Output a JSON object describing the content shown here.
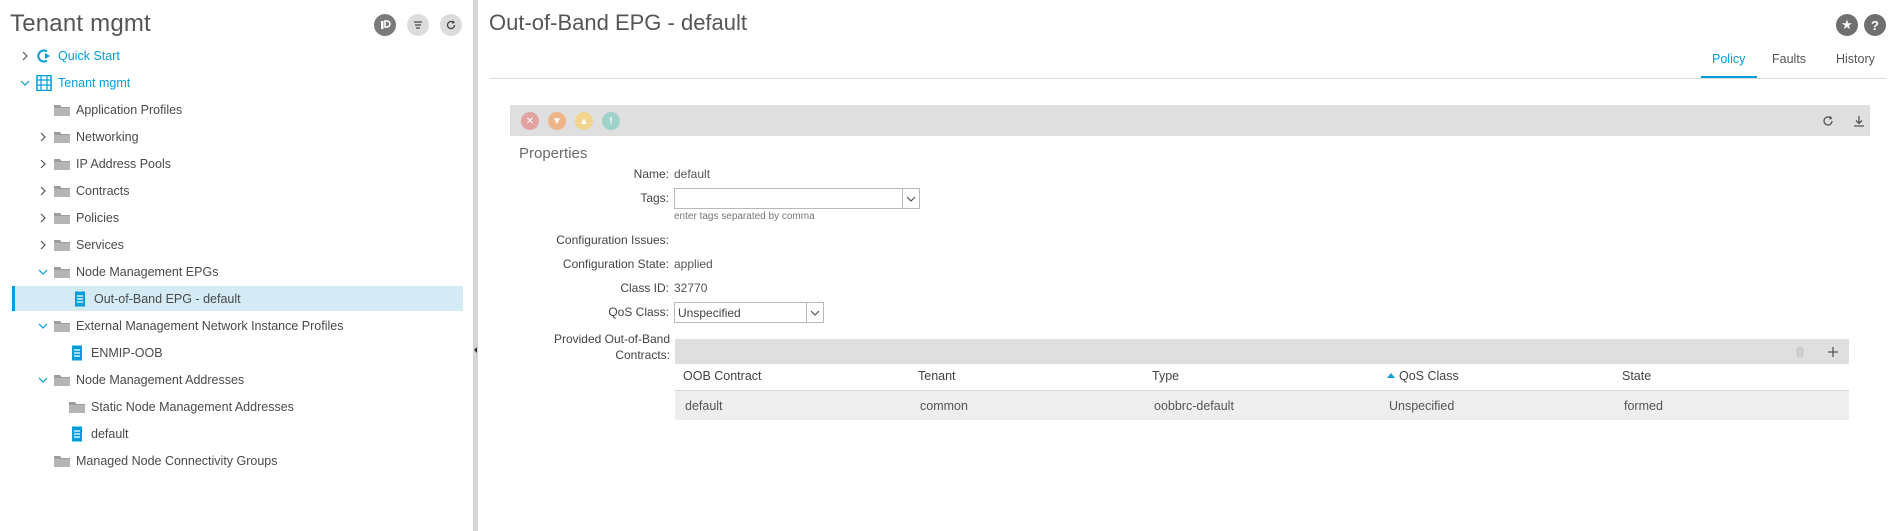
{
  "left_pane": {
    "title": "Tenant mgmt",
    "tree": [
      {
        "label": "Quick Start",
        "icon": "quick-start-icon",
        "chevron": "right",
        "level": 0
      },
      {
        "label": "Tenant mgmt",
        "icon": "tenant-icon",
        "chevron": "down",
        "level": 0
      },
      {
        "label": "Application Profiles",
        "icon": "folder-icon",
        "chevron": "none",
        "level": 1
      },
      {
        "label": "Networking",
        "icon": "folder-icon",
        "chevron": "right",
        "level": 1
      },
      {
        "label": "IP Address Pools",
        "icon": "folder-icon",
        "chevron": "right",
        "level": 1
      },
      {
        "label": "Contracts",
        "icon": "folder-icon",
        "chevron": "right",
        "level": 1
      },
      {
        "label": "Policies",
        "icon": "folder-icon",
        "chevron": "right",
        "level": 1
      },
      {
        "label": "Services",
        "icon": "folder-icon",
        "chevron": "right",
        "level": 1
      },
      {
        "label": "Node Management EPGs",
        "icon": "folder-icon",
        "chevron": "down",
        "level": 1
      },
      {
        "label": "Out-of-Band EPG - default",
        "icon": "document-icon",
        "chevron": "none",
        "level": 2,
        "selected": true
      },
      {
        "label": "External Management Network Instance Profiles",
        "icon": "folder-icon",
        "chevron": "down",
        "level": 1
      },
      {
        "label": "ENMIP-OOB",
        "icon": "document-icon",
        "chevron": "none",
        "level": 2
      },
      {
        "label": "Node Management Addresses",
        "icon": "folder-icon",
        "chevron": "down",
        "level": 1
      },
      {
        "label": "Static Node Management Addresses",
        "icon": "folder-icon",
        "chevron": "none",
        "level": 2
      },
      {
        "label": "default",
        "icon": "document-icon",
        "chevron": "none",
        "level": 2
      },
      {
        "label": "Managed Node Connectivity Groups",
        "icon": "folder-icon",
        "chevron": "none",
        "level": 1
      }
    ]
  },
  "main": {
    "title": "Out-of-Band EPG - default",
    "tabs": [
      "Policy",
      "Faults",
      "History"
    ],
    "active_tab": "Policy",
    "properties_heading": "Properties",
    "fields": {
      "name_label": "Name:",
      "name_value": "default",
      "tags_label": "Tags:",
      "tags_hint": "enter tags separated by comma",
      "config_issues_label": "Configuration Issues:",
      "config_state_label": "Configuration State:",
      "config_state_value": "applied",
      "class_id_label": "Class ID:",
      "class_id_value": "32770",
      "qos_label": "QoS Class:",
      "qos_value": "Unspecified",
      "contracts_label": "Provided Out-of-Band Contracts:"
    },
    "contracts_table": {
      "columns": [
        "OOB Contract",
        "Tenant",
        "Type",
        "QoS Class",
        "State"
      ],
      "sorted_column": "QoS Class",
      "rows": [
        [
          "default",
          "common",
          "oobbrc-default",
          "Unspecified",
          "formed"
        ]
      ]
    }
  },
  "colors": {
    "accent": "#049fd9",
    "selected_row": "#d4ebf5",
    "toolbar": "#dfdfdf",
    "fault_critical": "#e2a2a2",
    "fault_major": "#f0b489",
    "fault_minor": "#f1d58e",
    "fault_warning": "#9fd3c9"
  }
}
